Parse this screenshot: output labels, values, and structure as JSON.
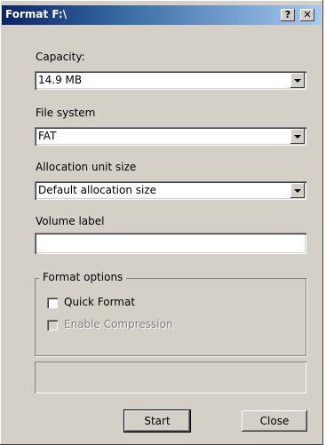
{
  "window": {
    "title": "Format F:\\",
    "help_label": "?",
    "close_label": "✕"
  },
  "capacity": {
    "label": "Capacity:",
    "value": "14.9 MB"
  },
  "file_system": {
    "label": "File system",
    "value": "FAT"
  },
  "allocation": {
    "label": "Allocation unit size",
    "value": "Default allocation size"
  },
  "volume_label": {
    "label": "Volume label",
    "value": ""
  },
  "format_options": {
    "legend": "Format options",
    "quick_format": {
      "label": "Quick Format",
      "checked": false,
      "enabled": true
    },
    "compression": {
      "label": "Enable Compression",
      "checked": false,
      "enabled": false
    }
  },
  "progress": {
    "value": 0
  },
  "buttons": {
    "start": "Start",
    "close": "Close"
  },
  "colors": {
    "dialog_face": "#d4d0c8",
    "titlebar_start": "#0a246a",
    "titlebar_end": "#a6caf0"
  },
  "icons": {
    "dropdown": "chevron-down-icon"
  }
}
